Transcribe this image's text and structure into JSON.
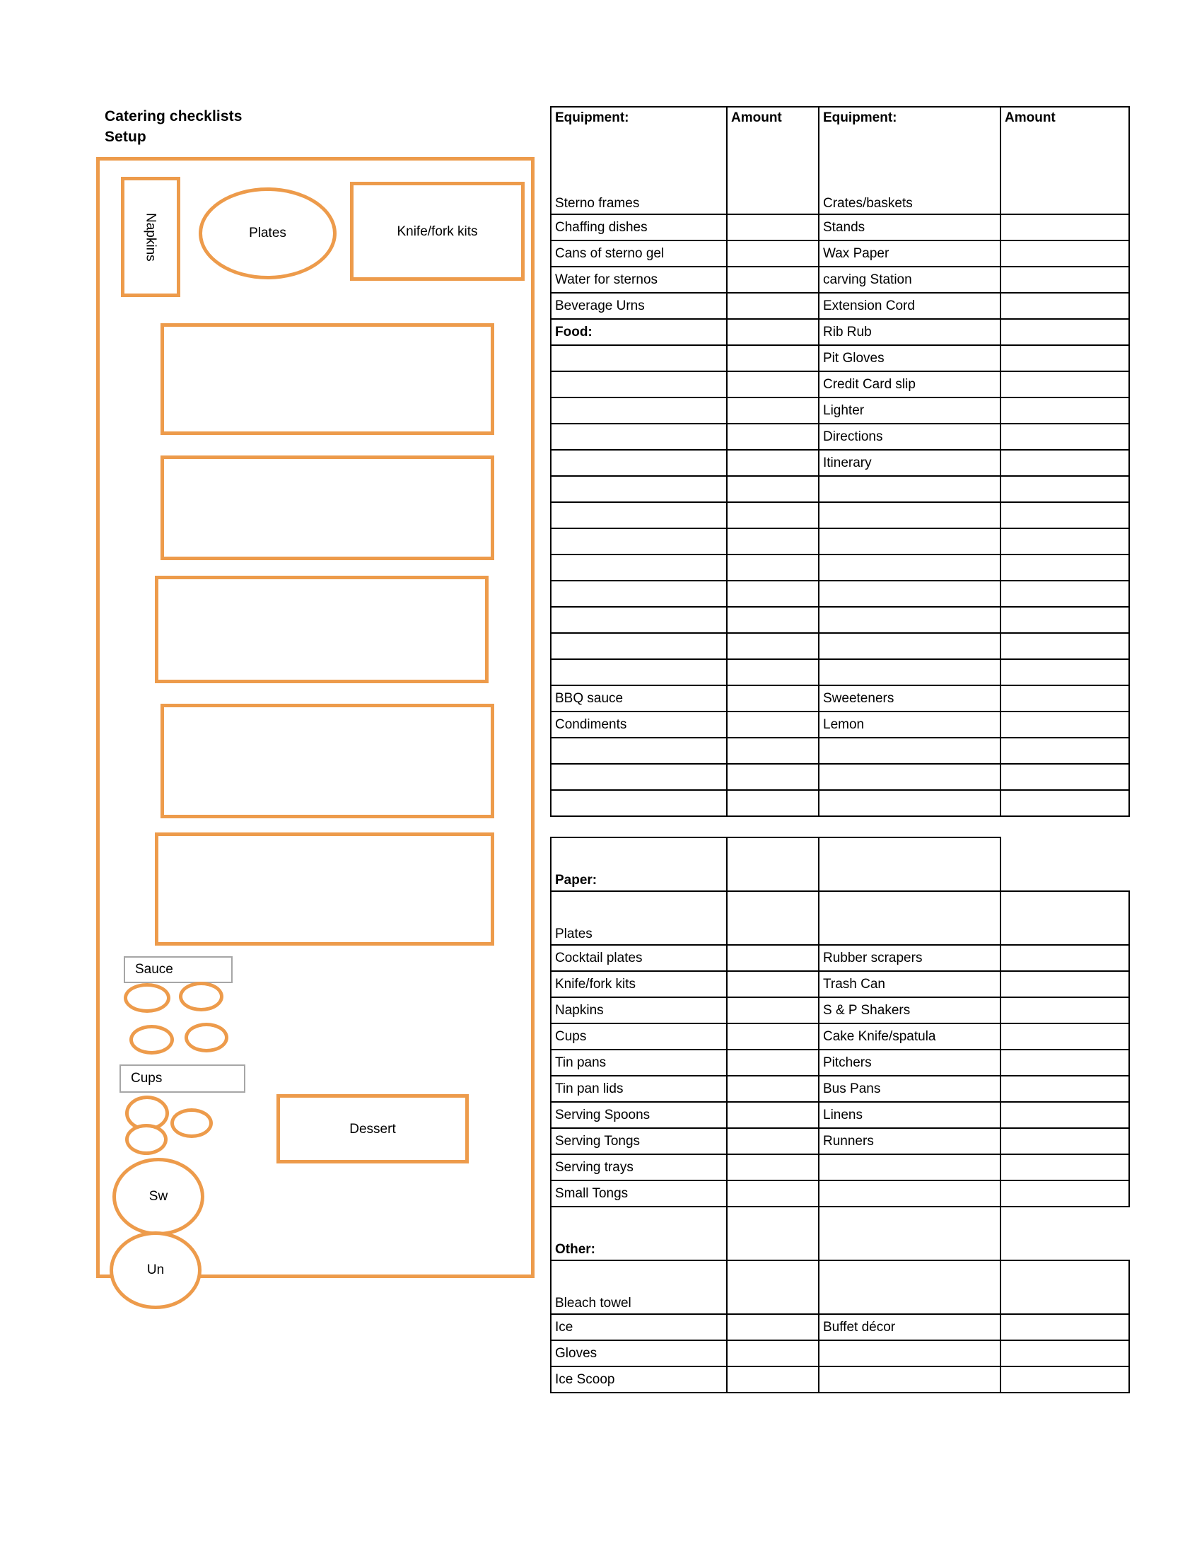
{
  "document": {
    "title_lines": [
      "Catering checklists",
      "Setup"
    ]
  },
  "colors": {
    "accent_orange": "#ED9B4B",
    "gray_border": "#A6A6A6",
    "table_border": "#000000"
  },
  "diagram": {
    "name": "Setup layout diagram",
    "shapes": [
      {
        "id": "napkins",
        "kind": "rect-vertical-label",
        "label": "Napkins"
      },
      {
        "id": "plates",
        "kind": "ellipse",
        "label": "Plates"
      },
      {
        "id": "knifefork",
        "kind": "rect",
        "label": "Knife/fork kits"
      },
      {
        "id": "table1",
        "kind": "rect",
        "label": ""
      },
      {
        "id": "table2",
        "kind": "rect",
        "label": ""
      },
      {
        "id": "table3",
        "kind": "rect",
        "label": ""
      },
      {
        "id": "table4",
        "kind": "rect",
        "label": ""
      },
      {
        "id": "table5",
        "kind": "rect",
        "label": ""
      },
      {
        "id": "sauce",
        "kind": "gray-rect",
        "label": "Sauce"
      },
      {
        "id": "cups",
        "kind": "gray-rect",
        "label": "Cups"
      },
      {
        "id": "dessert",
        "kind": "rect",
        "label": "Dessert"
      },
      {
        "id": "sw",
        "kind": "ellipse",
        "label": "Sw"
      },
      {
        "id": "un",
        "kind": "ellipse",
        "label": "Un"
      },
      {
        "id": "sauce-bowl-1",
        "kind": "ellipse",
        "label": ""
      },
      {
        "id": "sauce-bowl-2",
        "kind": "ellipse",
        "label": ""
      },
      {
        "id": "sauce-bowl-3",
        "kind": "ellipse",
        "label": ""
      },
      {
        "id": "sauce-bowl-4",
        "kind": "ellipse",
        "label": ""
      },
      {
        "id": "cup-stack-1",
        "kind": "ellipse",
        "label": ""
      },
      {
        "id": "cup-stack-2",
        "kind": "ellipse",
        "label": ""
      },
      {
        "id": "cup-stack-3",
        "kind": "ellipse",
        "label": ""
      }
    ]
  },
  "checklist": {
    "headers": [
      "Equipment:",
      "Amount",
      "Equipment:",
      "Amount"
    ],
    "rows": [
      {
        "c0": "Sterno frames",
        "c1": "",
        "c2": "Crates/baskets",
        "c3": "",
        "style": "header-body"
      },
      {
        "c0": "Chaffing dishes",
        "c1": "",
        "c2": "Stands",
        "c3": ""
      },
      {
        "c0": "Cans of sterno gel",
        "c1": "",
        "c2": "Wax Paper",
        "c3": ""
      },
      {
        "c0": "Water for sternos",
        "c1": "",
        "c2": "carving Station",
        "c3": ""
      },
      {
        "c0": "Beverage Urns",
        "c1": "",
        "c2": "Extension Cord",
        "c3": ""
      },
      {
        "c0": "Food:",
        "c1": "",
        "c2": "Rib Rub",
        "c3": "",
        "bold0": true
      },
      {
        "c0": "",
        "c1": "",
        "c2": "Pit Gloves",
        "c3": ""
      },
      {
        "c0": "",
        "c1": "",
        "c2": "Credit Card slip",
        "c3": ""
      },
      {
        "c0": "",
        "c1": "",
        "c2": "Lighter",
        "c3": ""
      },
      {
        "c0": "",
        "c1": "",
        "c2": "Directions",
        "c3": ""
      },
      {
        "c0": "",
        "c1": "",
        "c2": "Itinerary",
        "c3": ""
      },
      {
        "c0": "",
        "c1": "",
        "c2": "",
        "c3": ""
      },
      {
        "c0": "",
        "c1": "",
        "c2": "",
        "c3": ""
      },
      {
        "c0": "",
        "c1": "",
        "c2": "",
        "c3": ""
      },
      {
        "c0": "",
        "c1": "",
        "c2": "",
        "c3": ""
      },
      {
        "c0": "",
        "c1": "",
        "c2": "",
        "c3": ""
      },
      {
        "c0": "",
        "c1": "",
        "c2": "",
        "c3": ""
      },
      {
        "c0": "",
        "c1": "",
        "c2": "",
        "c3": ""
      },
      {
        "c0": "",
        "c1": "",
        "c2": "",
        "c3": ""
      },
      {
        "c0": "BBQ sauce",
        "c1": "",
        "c2": "Sweeteners",
        "c3": ""
      },
      {
        "c0": "Condiments",
        "c1": "",
        "c2": "Lemon",
        "c3": ""
      },
      {
        "c0": "",
        "c1": "",
        "c2": "",
        "c3": ""
      },
      {
        "c0": "",
        "c1": "",
        "c2": "",
        "c3": ""
      },
      {
        "c0": "",
        "c1": "",
        "c2": "",
        "c3": ""
      }
    ],
    "rows_section2": [
      {
        "c0": "Paper:",
        "c1": "",
        "c2": "",
        "c3": "",
        "bold0": true,
        "tall": true
      },
      {
        "c0": "Plates",
        "c1": "",
        "c2": "",
        "c3": "",
        "tall": true
      },
      {
        "c0": "Cocktail plates",
        "c1": "",
        "c2": "Rubber scrapers",
        "c3": ""
      },
      {
        "c0": "Knife/fork kits",
        "c1": "",
        "c2": "Trash Can",
        "c3": ""
      },
      {
        "c0": "Napkins",
        "c1": "",
        "c2": "S & P Shakers",
        "c3": ""
      },
      {
        "c0": "Cups",
        "c1": "",
        "c2": "Cake Knife/spatula",
        "c3": ""
      },
      {
        "c0": "Tin pans",
        "c1": "",
        "c2": "Pitchers",
        "c3": ""
      },
      {
        "c0": "Tin pan lids",
        "c1": "",
        "c2": "Bus Pans",
        "c3": ""
      },
      {
        "c0": "Serving Spoons",
        "c1": "",
        "c2": "Linens",
        "c3": ""
      },
      {
        "c0": "Serving Tongs",
        "c1": "",
        "c2": "Runners",
        "c3": ""
      },
      {
        "c0": "Serving trays",
        "c1": "",
        "c2": "",
        "c3": ""
      },
      {
        "c0": "Small Tongs",
        "c1": "",
        "c2": "",
        "c3": ""
      }
    ],
    "rows_section3": [
      {
        "c0": "Other:",
        "c1": "",
        "c2": "",
        "c3": "",
        "bold0": true,
        "tall": true
      },
      {
        "c0": "Bleach towel",
        "c1": "",
        "c2": "",
        "c3": "",
        "tall": true
      },
      {
        "c0": "Ice",
        "c1": "",
        "c2": "Buffet décor",
        "c3": ""
      },
      {
        "c0": "Gloves",
        "c1": "",
        "c2": "",
        "c3": ""
      },
      {
        "c0": "Ice Scoop",
        "c1": "",
        "c2": "",
        "c3": ""
      }
    ]
  }
}
